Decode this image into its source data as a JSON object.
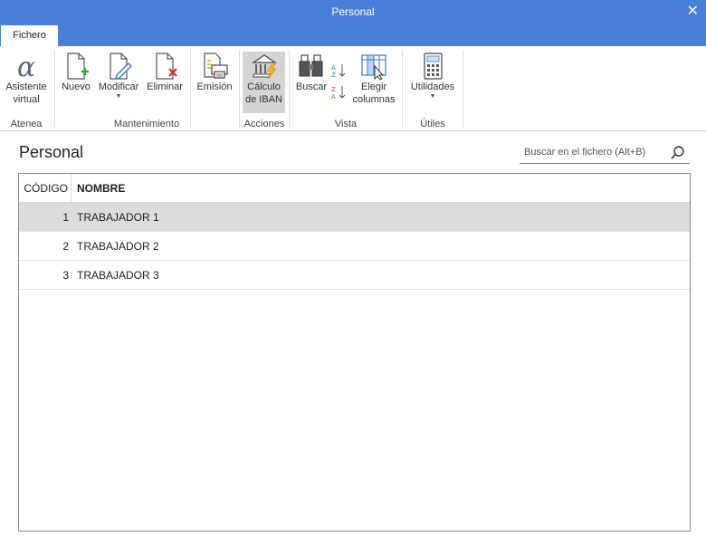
{
  "window": {
    "title": "Personal",
    "close": "✕"
  },
  "tabs": [
    {
      "label": "Fichero"
    }
  ],
  "ribbon": {
    "groups": {
      "atenea": "Atenea",
      "mantenimiento": "Mantenimiento",
      "acciones": "Acciones",
      "vista": "Vista",
      "utiles": "Útiles"
    },
    "buttons": {
      "asistente": [
        "Asistente",
        "virtual"
      ],
      "nuevo": "Nuevo",
      "modificar": "Modificar",
      "eliminar": "Eliminar",
      "emision": "Emisión",
      "iban": [
        "Cálculo",
        "de IBAN"
      ],
      "buscar": "Buscar",
      "elegir": [
        "Elegir",
        "columnas"
      ],
      "utilidades": "Utilidades"
    },
    "dropdown_glyph": "▼"
  },
  "page": {
    "title": "Personal"
  },
  "search": {
    "placeholder": "Buscar en el fichero (Alt+B)"
  },
  "table": {
    "columns": [
      "CÓDIGO",
      "NOMBRE"
    ],
    "rows": [
      {
        "codigo": "1",
        "nombre": "TRABAJADOR 1"
      },
      {
        "codigo": "2",
        "nombre": "TRABAJADOR 2"
      },
      {
        "codigo": "3",
        "nombre": "TRABAJADOR 3"
      }
    ],
    "selected_row": 0
  },
  "colors": {
    "titlebar": "#4a7fd9",
    "selection": "#dcdcdc",
    "accent_green": "#2e9e3f",
    "accent_red": "#d32f2f"
  }
}
